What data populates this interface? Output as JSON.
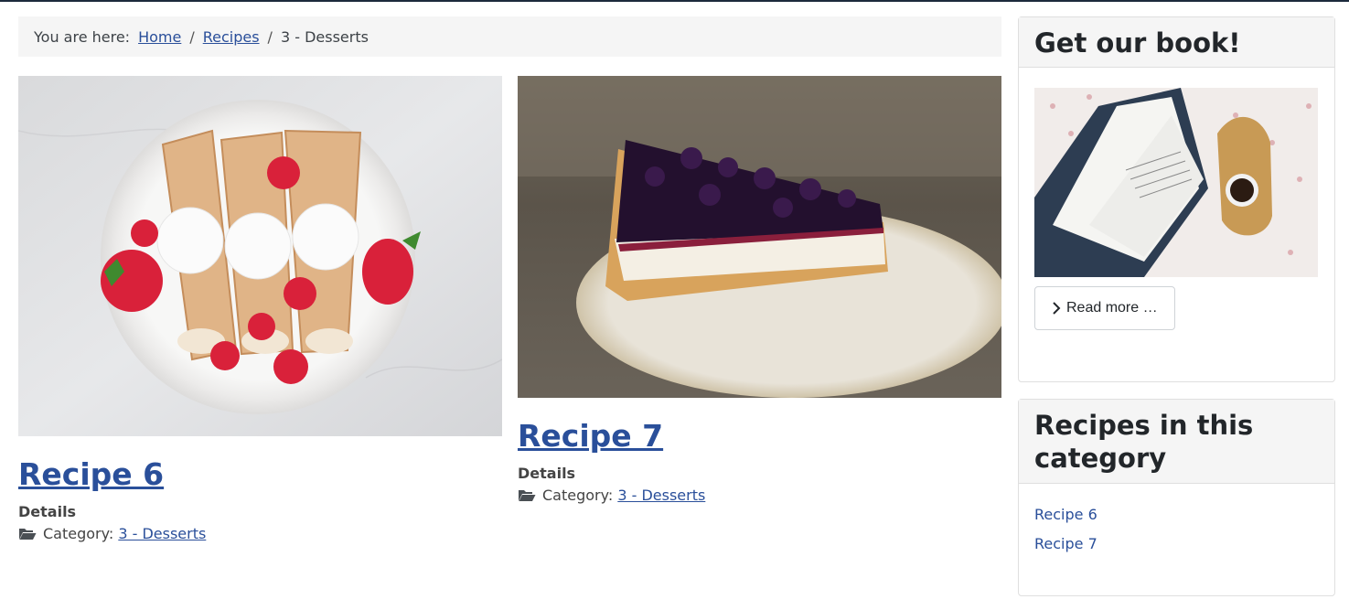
{
  "breadcrumb": {
    "prefix": "You are here:",
    "items": [
      {
        "label": "Home"
      },
      {
        "label": "Recipes"
      },
      {
        "label": "3 - Desserts"
      }
    ],
    "separator": "/"
  },
  "articles": [
    {
      "title": "Recipe 6",
      "image": "crepes with strawberries and whipped cream",
      "details_label": "Details",
      "category_label": "Category:",
      "category_value": "3 - Desserts"
    },
    {
      "title": "Recipe 7",
      "image": "blueberry cheesecake slice",
      "details_label": "Details",
      "category_label": "Category:",
      "category_value": "3 - Desserts"
    }
  ],
  "sidebar": {
    "book_card": {
      "title": "Get our book!",
      "image": "open cookbook with cup of coffee",
      "read_more_label": "Read more …"
    },
    "category_card": {
      "title": "Recipes in this category",
      "items": [
        {
          "label": "Recipe 6"
        },
        {
          "label": "Recipe 7"
        }
      ]
    }
  },
  "colors": {
    "link": "#2a4f9a",
    "breadcrumb_bg": "#f5f5f5",
    "top_border": "#1c2a3c"
  }
}
